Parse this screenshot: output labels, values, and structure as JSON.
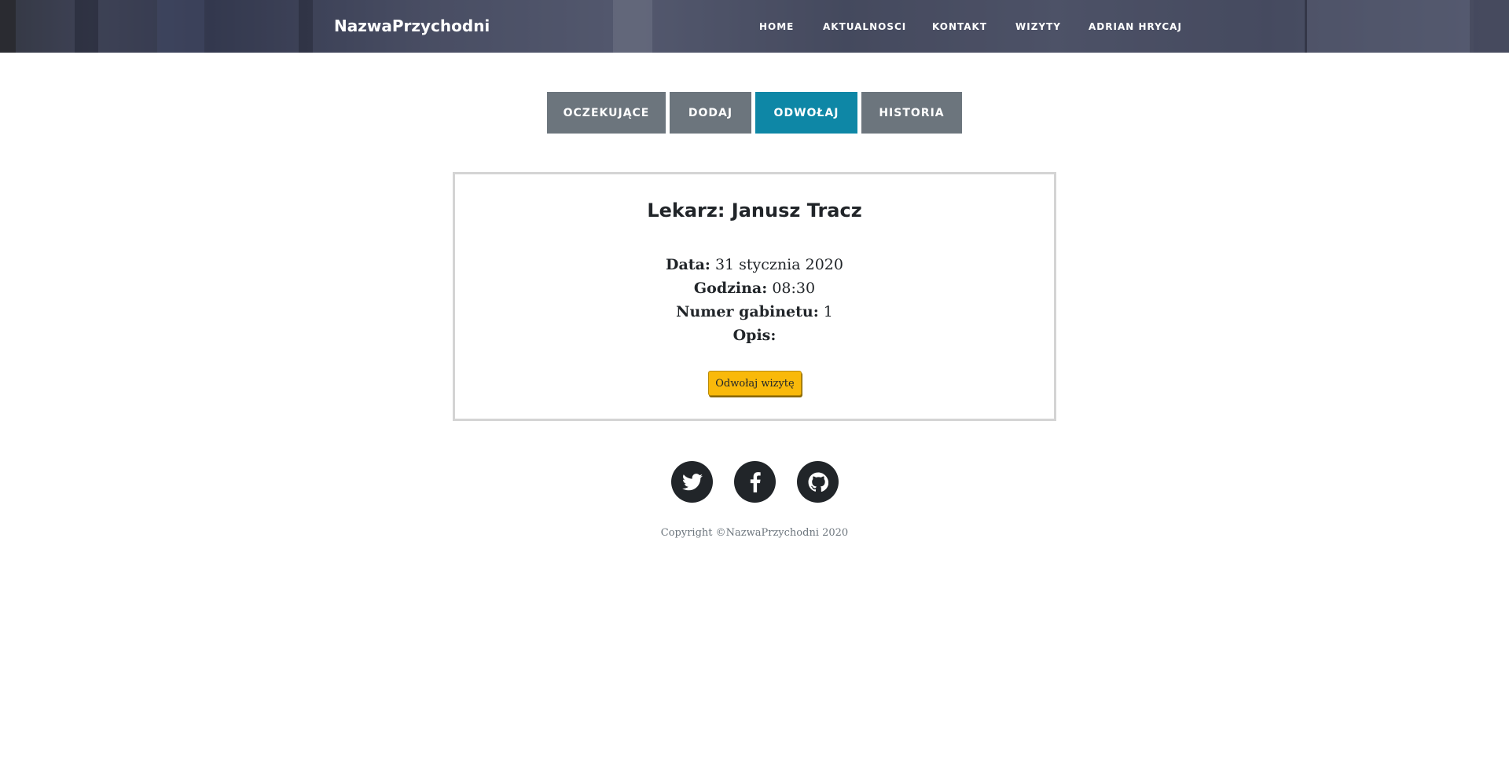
{
  "header": {
    "brand": "NazwaPrzychodni",
    "nav": [
      {
        "label": "HOME"
      },
      {
        "label": "AKTUALNOSCI"
      },
      {
        "label": "KONTAKT"
      },
      {
        "label": "WIZYTY"
      },
      {
        "label": "ADRIAN HRYCAJ"
      }
    ]
  },
  "tabs": [
    {
      "label": "OCZEKUJĄCE",
      "active": false
    },
    {
      "label": "DODAJ",
      "active": false
    },
    {
      "label": "ODWOŁAJ",
      "active": true
    },
    {
      "label": "HISTORIA",
      "active": false
    }
  ],
  "visit": {
    "doctor_label": "Lekarz: Janusz Tracz",
    "date_label": "Data:",
    "date_value": "31 stycznia 2020",
    "time_label": "Godzina:",
    "time_value": "08:30",
    "room_label": "Numer gabinetu:",
    "room_value": "1",
    "description_label": "Opis:",
    "description_value": "",
    "cancel_button": "Odwołaj wizytę"
  },
  "footer": {
    "social": [
      {
        "icon": "twitter-icon"
      },
      {
        "icon": "facebook-icon"
      },
      {
        "icon": "github-icon"
      }
    ],
    "copyright": "Copyright ©NazwaPrzychodni 2020"
  },
  "colors": {
    "active_tab": "#0e87a6",
    "inactive_tab": "#6c757d",
    "cancel_button": "#f9b90a",
    "social_bg": "#212529"
  }
}
